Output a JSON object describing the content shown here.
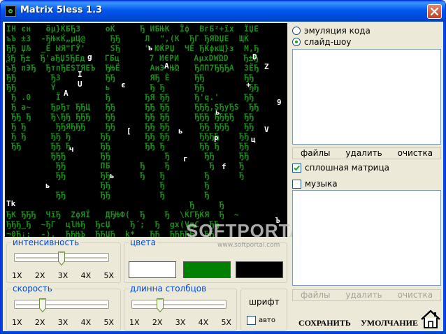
{
  "window": {
    "title": "Matrix 5less 1.3",
    "icon": "matrix-app-icon",
    "close_icon": "close-icon"
  },
  "preview": {
    "rows": [
      "ΙΗ єн   ӫµ}ЌБЂЗ     оЌ     Ђ ИБЊК  Ϊф  ВгБ²+їх  ЇЏЕ",
      "ъЪ ±З  -ЂЊкЌ„µЦ@     ЂЂ     Л  \",(К  ЂГ ЂЯΏЏЕ  ЩЌ",
      "ЂЂ ЏЉ  _Ё ЫЯ\"ГЎ'     ЅЂ     \" ЮЌРЏ  ЧЁ ЂЌфкЩ}з  М,Ђ",
      "ѮЂ Ђ±  Ђ'аЂЏ5ЂЕд    ГБц      7 ИЄРИ   АµхDWΏD   Ђ±Ђ",
      "ъЂ пЭЂ  ЂтпЂЕЅТЯЕЪ  ЂЊЁ      АиЭ ЊΏ   ЂЛП7ЂЂЂА  ЗЁЂ",
      "ЂЂ       ЂЗ         ЂЂ       ЯЂ Ѐ     ЂЂ        ЂЂ",
      "ЂЂ       Ϋ          ь        Ђ Ђ      ЂЂ         ЂЂ",
      " Ђ .0     Ϊ         Ђ       ЂЯ ЂЂ     Ђ'q.'     ЂЂ",
      " Ђ а~    ЂрЂт ЂЂЦ   ЂЂ      ЂЂ ЂЂ     ЂЂЂ,ЅЂуЂЅ  ЂЂ",
      " ЂЂ Ђ    Ђ\\ЂЂ ЂЂЂ   ЂЂ      ЂЂ ЂЂ     ЂЂЂ ЂЂЂЂ  ЂЂ",
      " Ђ Ђ      ЂЂЯЂЂЂ    ЂЂ      ЂЂ ЂЂ      ЂЂ ЂЂЂ   ЂЂ",
      " Ђ Ђ     ЂЂ Ђ      ЂЂ       ЂЂ ЂЂ      ЂЂЂЂ    ЂЂ",
      " ЂЂ      ЂЂ Ђ      ЂЂ       ЂЂ Ђ       ЂЂ Ђ    ЂЂ",
      "         ЂЂЂ       ЂЂ           Ђ       ЂЂ     ЂЂ",
      "          ЂЂ       ПБ      Ђ    Ђ        Ђ     Ђ",
      "          ЂЂ       ЂЂ      Ђ   Ђ        Ђ      Ђ",
      "                   ЂЂ          Ђ        Ђ",
      "          ЂЂ       ЂЂ          Ђ        Ђ",
      "                                     Ђ     Ђ",
      "ЂΚ ЂЂЂ  ЧїЂ  ZфЯЇ   ДЂЊФ(  Ђ    Ђ  \\ЌГЂЌЯ  Ђ  ~",
      "ЂЂЂ_Ђ  ~ЂГ  цlЊЂ  ЂсЏ    Ђ´;  Ђ  gх(VдС  ЂЂ",
      "¬0Ђ¡:  -),  ЂЂЊЪ  ЂЂЏЂ  k*   ЂЂ  ЂЂЂЂЂ  ЂЂ",
      "ЧЂЖЖЏ  (9F  КУЋЊ  wЌє)  ЏЪ   Ђ  ЂЂЂЂ   ЂЂ"
    ],
    "highlights": [
      "g",
      "I",
      "A",
      "U",
      "є",
      "A",
      "ь",
      "D",
      "Z",
      "+",
      "9",
      "ь",
      "V",
      "[",
      "ь",
      "P",
      "ц",
      "ч",
      "г",
      "f",
      "ь",
      "ь",
      "Ъ",
      "Tk"
    ]
  },
  "watermark": {
    "brand": "SOFTPORTAL",
    "url": "www.softportal.com"
  },
  "intensity": {
    "label": "интенсивность",
    "ticks": [
      "1X",
      "2X",
      "3X",
      "4X",
      "5X"
    ],
    "value_fraction": 0.5
  },
  "colors": {
    "label": "цвета",
    "swatches": [
      "#ffffff",
      "#008000",
      "#000000"
    ]
  },
  "speed": {
    "label": "скорость",
    "ticks": [
      "1X",
      "2X",
      "3X",
      "4X",
      "5X"
    ],
    "value_fraction": 0.27
  },
  "column_length": {
    "label": "длинна столбцов",
    "ticks": [
      "1X",
      "2X",
      "3X",
      "4X",
      "5X"
    ],
    "value_fraction": 0.27
  },
  "font": {
    "label": "шрифт",
    "auto_label": "авто",
    "auto_checked": false
  },
  "mode": {
    "options": [
      {
        "label": "эмуляция кода",
        "selected": false
      },
      {
        "label": "слайд-шоу",
        "selected": true
      }
    ]
  },
  "slideshow_files": {
    "buttons": [
      "файлы",
      "удалить",
      "очистка"
    ]
  },
  "solid_matrix": {
    "label": "сплошная матрица",
    "checked": true
  },
  "music": {
    "label": "музыка",
    "checked": false,
    "buttons": [
      "файлы",
      "удалить",
      "очистка"
    ]
  },
  "footer": {
    "save_label": "СОХРАНИТЬ",
    "default_label": "УМОЛЧАНИЕ",
    "home_icon": "home-icon"
  }
}
